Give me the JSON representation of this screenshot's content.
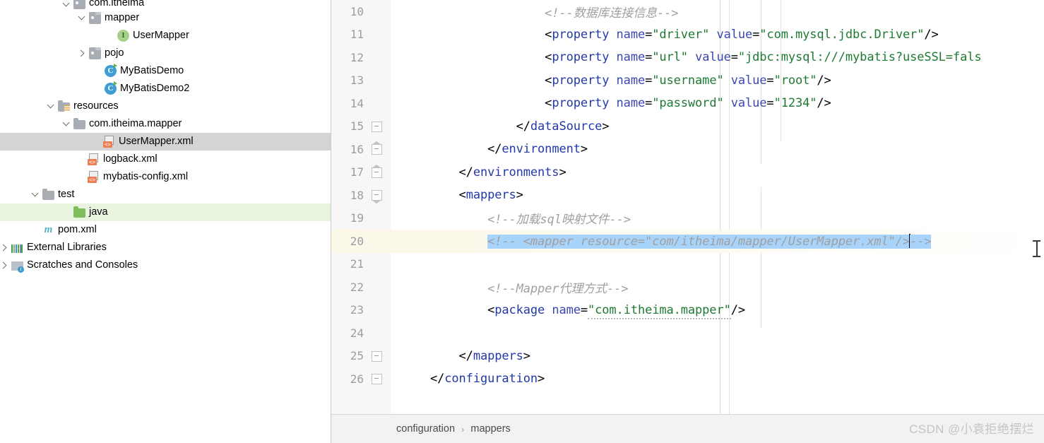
{
  "project_tree": {
    "items": [
      {
        "label": "com.itheima",
        "twisty": "down",
        "icon": "package-folder-icon",
        "indent": 88,
        "state": "clipped"
      },
      {
        "label": "mapper",
        "twisty": "down",
        "icon": "package-folder-icon",
        "indent": 110,
        "state": "normal"
      },
      {
        "label": "UserMapper",
        "twisty": "none",
        "icon": "interface-icon",
        "indent": 150,
        "state": "normal"
      },
      {
        "label": "pojo",
        "twisty": "right",
        "icon": "package-folder-icon",
        "indent": 110,
        "state": "normal"
      },
      {
        "label": "MyBatisDemo",
        "twisty": "none",
        "icon": "java-class-icon",
        "indent": 132,
        "state": "normal"
      },
      {
        "label": "MyBatisDemo2",
        "twisty": "none",
        "icon": "java-class-icon",
        "indent": 132,
        "state": "normal"
      },
      {
        "label": "resources",
        "twisty": "down",
        "icon": "resources-folder-icon",
        "indent": 66,
        "state": "normal"
      },
      {
        "label": "com.itheima.mapper",
        "twisty": "down",
        "icon": "folder-icon",
        "indent": 88,
        "state": "normal"
      },
      {
        "label": "UserMapper.xml",
        "twisty": "none",
        "icon": "xml-file-icon",
        "indent": 130,
        "state": "selected"
      },
      {
        "label": "logback.xml",
        "twisty": "none",
        "icon": "xml-file-icon",
        "indent": 108,
        "state": "normal"
      },
      {
        "label": "mybatis-config.xml",
        "twisty": "none",
        "icon": "xml-file-icon",
        "indent": 108,
        "state": "normal"
      },
      {
        "label": "test",
        "twisty": "down",
        "icon": "folder-icon",
        "indent": 44,
        "state": "normal"
      },
      {
        "label": "java",
        "twisty": "none",
        "icon": "source-folder-icon",
        "indent": 88,
        "state": "green"
      },
      {
        "label": "pom.xml",
        "twisty": "none",
        "icon": "maven-icon",
        "indent": 44,
        "state": "normal"
      },
      {
        "label": "External Libraries",
        "twisty": "right",
        "icon": "libraries-icon",
        "indent": 0,
        "state": "normal"
      },
      {
        "label": "Scratches and Consoles",
        "twisty": "right",
        "icon": "scratches-icon",
        "indent": 0,
        "state": "normal"
      }
    ]
  },
  "editor": {
    "lines": [
      {
        "num": "10",
        "fold": "none",
        "current": false,
        "tokens": [
          {
            "t": "                ",
            "c": "tk-punct"
          },
          {
            "t": "<!--数据库连接信息-->",
            "c": "tk-cmt"
          }
        ]
      },
      {
        "num": "11",
        "fold": "none",
        "current": false,
        "tokens": [
          {
            "t": "                ",
            "c": "tk-punct"
          },
          {
            "t": "<",
            "c": "tk-punct"
          },
          {
            "t": "property",
            "c": "tk-tag"
          },
          {
            "t": " ",
            "c": "tk-punct"
          },
          {
            "t": "name",
            "c": "tk-attr"
          },
          {
            "t": "=",
            "c": "tk-punct"
          },
          {
            "t": "\"driver\"",
            "c": "tk-val"
          },
          {
            "t": " ",
            "c": "tk-punct"
          },
          {
            "t": "value",
            "c": "tk-attr"
          },
          {
            "t": "=",
            "c": "tk-punct"
          },
          {
            "t": "\"com.mysql.jdbc.Driver\"",
            "c": "tk-val"
          },
          {
            "t": "/>",
            "c": "tk-punct"
          }
        ]
      },
      {
        "num": "12",
        "fold": "none",
        "current": false,
        "tokens": [
          {
            "t": "                ",
            "c": "tk-punct"
          },
          {
            "t": "<",
            "c": "tk-punct"
          },
          {
            "t": "property",
            "c": "tk-tag"
          },
          {
            "t": " ",
            "c": "tk-punct"
          },
          {
            "t": "name",
            "c": "tk-attr"
          },
          {
            "t": "=",
            "c": "tk-punct"
          },
          {
            "t": "\"url\"",
            "c": "tk-val"
          },
          {
            "t": " ",
            "c": "tk-punct"
          },
          {
            "t": "value",
            "c": "tk-attr"
          },
          {
            "t": "=",
            "c": "tk-punct"
          },
          {
            "t": "\"jdbc:mysql:///mybatis?useSSL=fals",
            "c": "tk-val"
          }
        ]
      },
      {
        "num": "13",
        "fold": "none",
        "current": false,
        "tokens": [
          {
            "t": "                ",
            "c": "tk-punct"
          },
          {
            "t": "<",
            "c": "tk-punct"
          },
          {
            "t": "property",
            "c": "tk-tag"
          },
          {
            "t": " ",
            "c": "tk-punct"
          },
          {
            "t": "name",
            "c": "tk-attr"
          },
          {
            "t": "=",
            "c": "tk-punct"
          },
          {
            "t": "\"username\"",
            "c": "tk-val"
          },
          {
            "t": " ",
            "c": "tk-punct"
          },
          {
            "t": "value",
            "c": "tk-attr"
          },
          {
            "t": "=",
            "c": "tk-punct"
          },
          {
            "t": "\"root\"",
            "c": "tk-val"
          },
          {
            "t": "/>",
            "c": "tk-punct"
          }
        ]
      },
      {
        "num": "14",
        "fold": "none",
        "current": false,
        "tokens": [
          {
            "t": "                ",
            "c": "tk-punct"
          },
          {
            "t": "<",
            "c": "tk-punct"
          },
          {
            "t": "property",
            "c": "tk-tag"
          },
          {
            "t": " ",
            "c": "tk-punct"
          },
          {
            "t": "name",
            "c": "tk-attr"
          },
          {
            "t": "=",
            "c": "tk-punct"
          },
          {
            "t": "\"password\"",
            "c": "tk-val"
          },
          {
            "t": " ",
            "c": "tk-punct"
          },
          {
            "t": "value",
            "c": "tk-attr"
          },
          {
            "t": "=",
            "c": "tk-punct"
          },
          {
            "t": "\"1234\"",
            "c": "tk-val"
          },
          {
            "t": "/>",
            "c": "tk-punct"
          }
        ]
      },
      {
        "num": "15",
        "fold": "box",
        "current": false,
        "tokens": [
          {
            "t": "            ",
            "c": "tk-punct"
          },
          {
            "t": "</",
            "c": "tk-punct"
          },
          {
            "t": "dataSource",
            "c": "tk-tag"
          },
          {
            "t": ">",
            "c": "tk-punct"
          }
        ]
      },
      {
        "num": "16",
        "fold": "pent",
        "current": false,
        "tokens": [
          {
            "t": "        ",
            "c": "tk-punct"
          },
          {
            "t": "</",
            "c": "tk-punct"
          },
          {
            "t": "environment",
            "c": "tk-tag"
          },
          {
            "t": ">",
            "c": "tk-punct"
          }
        ]
      },
      {
        "num": "17",
        "fold": "pent",
        "current": false,
        "tokens": [
          {
            "t": "    ",
            "c": "tk-punct"
          },
          {
            "t": "</",
            "c": "tk-punct"
          },
          {
            "t": "environments",
            "c": "tk-tag"
          },
          {
            "t": ">",
            "c": "tk-punct"
          }
        ]
      },
      {
        "num": "18",
        "fold": "pent-down",
        "current": false,
        "tokens": [
          {
            "t": "    ",
            "c": "tk-punct"
          },
          {
            "t": "<",
            "c": "tk-punct"
          },
          {
            "t": "mappers",
            "c": "tk-tag"
          },
          {
            "t": ">",
            "c": "tk-punct"
          }
        ]
      },
      {
        "num": "19",
        "fold": "none",
        "current": false,
        "tokens": [
          {
            "t": "        ",
            "c": "tk-punct"
          },
          {
            "t": "<!--加载sql映射文件-->",
            "c": "tk-cmt"
          }
        ]
      },
      {
        "num": "20",
        "fold": "none",
        "current": true,
        "selected_text": "<!-- <mapper resource=\"com/itheima/mapper/UserMapper.xml\"/>",
        "selected_tail": "-->",
        "caret": true,
        "tokens": []
      },
      {
        "num": "21",
        "fold": "none",
        "current": false,
        "tokens": []
      },
      {
        "num": "22",
        "fold": "none",
        "current": false,
        "tokens": [
          {
            "t": "        ",
            "c": "tk-punct"
          },
          {
            "t": "<!--Mapper代理方式-->",
            "c": "tk-cmt"
          }
        ]
      },
      {
        "num": "23",
        "fold": "none",
        "current": false,
        "tokens": [
          {
            "t": "        ",
            "c": "tk-punct"
          },
          {
            "t": "<",
            "c": "tk-punct"
          },
          {
            "t": "package",
            "c": "tk-tag"
          },
          {
            "t": " ",
            "c": "tk-punct"
          },
          {
            "t": "name",
            "c": "tk-attr"
          },
          {
            "t": "=",
            "c": "tk-punct"
          },
          {
            "t": "\"com.itheima.mapper\"",
            "c": "tk-val squiggle"
          },
          {
            "t": "/>",
            "c": "tk-punct"
          }
        ]
      },
      {
        "num": "24",
        "fold": "none",
        "current": false,
        "tokens": []
      },
      {
        "num": "25",
        "fold": "box",
        "current": false,
        "tokens": [
          {
            "t": "    ",
            "c": "tk-punct"
          },
          {
            "t": "</",
            "c": "tk-punct"
          },
          {
            "t": "mappers",
            "c": "tk-tag"
          },
          {
            "t": ">",
            "c": "tk-punct"
          }
        ]
      },
      {
        "num": "26",
        "fold": "box",
        "current": false,
        "tokens": [
          {
            "t": "</",
            "c": "tk-punct"
          },
          {
            "t": "configuration",
            "c": "tk-tag"
          },
          {
            "t": ">",
            "c": "tk-punct"
          }
        ]
      }
    ]
  },
  "breadcrumb": {
    "items": [
      "configuration",
      "mappers"
    ],
    "separator": "›"
  },
  "watermark": {
    "text": "CSDN @小袁拒绝摆烂"
  },
  "colors": {
    "selection_blue": "#a8d3fb",
    "current_line": "#fcf8e8",
    "tree_selected": "#d4d4d4",
    "tree_green": "#e8f3e0",
    "xml_tag": "#2238a8",
    "xml_attr": "#3b47b0",
    "xml_value": "#1d7a32",
    "comment_gray": "#a0a0a0",
    "gutter_text": "#9a9ea3"
  }
}
